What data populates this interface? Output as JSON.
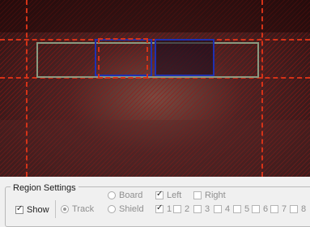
{
  "region_settings": {
    "title": "Region Settings",
    "show_label": "Show",
    "track_label": "Track",
    "board_label": "Board",
    "shield_label": "Shield",
    "left_label": "Left",
    "right_label": "Right",
    "numbers": [
      "1",
      "2",
      "3",
      "4",
      "5",
      "6",
      "7",
      "8"
    ]
  }
}
